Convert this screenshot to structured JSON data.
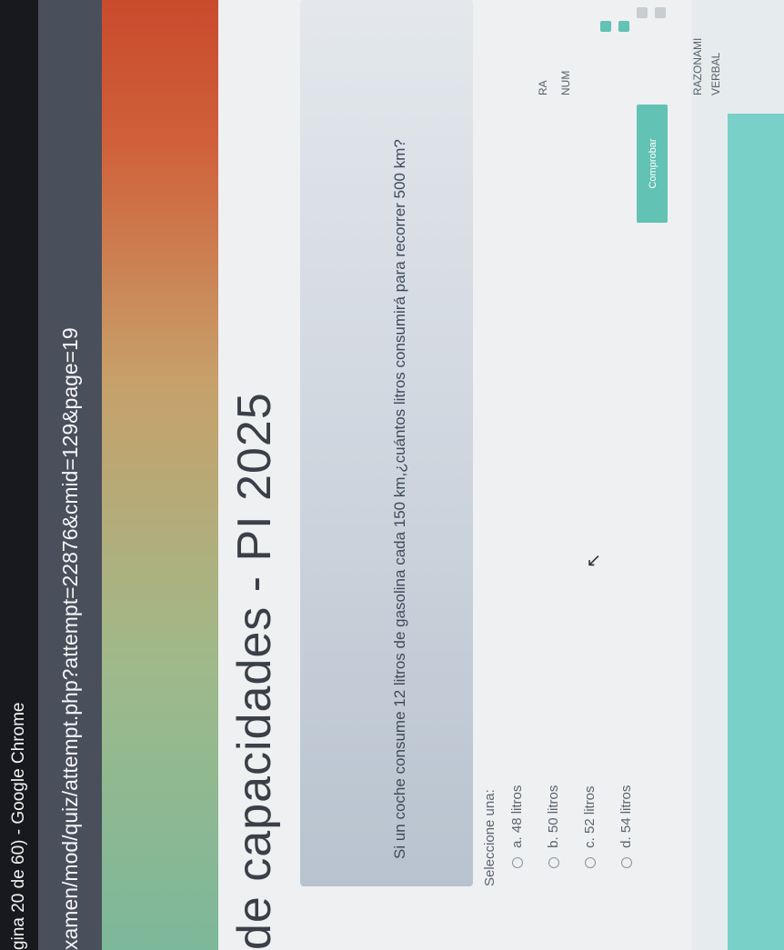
{
  "window": {
    "title": "gina 20 de 60) - Google Chrome"
  },
  "address_bar": {
    "url": "xamen/mod/quiz/attempt.php?attempt=22876&cmid=129&page=19"
  },
  "page": {
    "heading": "de capacidades - PI 2025"
  },
  "question": {
    "text": "Si un coche consume 12 litros de gasolina cada 150 km,¿cuántos litros consumirá para recorrer 500 km?",
    "prompt": "Seleccione una:",
    "options": [
      {
        "label": "a. 48 litros"
      },
      {
        "label": "b. 50 litros"
      },
      {
        "label": "c. 52 litros"
      },
      {
        "label": "d. 54 litros"
      }
    ]
  },
  "actions": {
    "check_label": "Comprobar"
  },
  "sidebar": {
    "line1": "RA",
    "line2": "NUM",
    "line3": "RAZONAMI",
    "line4": "VERBAL"
  },
  "colors": {
    "accent": "#62c2b4",
    "title_bar": "#17191e",
    "address_bar": "#4a4f5c"
  }
}
